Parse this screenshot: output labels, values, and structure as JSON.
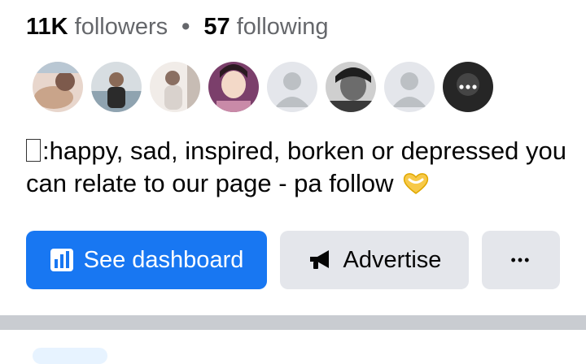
{
  "stats": {
    "followers_count": "11K",
    "followers_label": "followers",
    "separator": "•",
    "following_count": "57",
    "following_label": "following"
  },
  "follower_avatars": [
    {
      "kind": "photo",
      "colors": [
        "#c9a48a",
        "#7d5a4c",
        "#e8d6cc"
      ]
    },
    {
      "kind": "photo",
      "colors": [
        "#8fa3b0",
        "#2b2b2b",
        "#d7dde1"
      ]
    },
    {
      "kind": "photo",
      "colors": [
        "#d9d2cd",
        "#8a6f62",
        "#f1ece8"
      ]
    },
    {
      "kind": "photo",
      "colors": [
        "#7b3f6b",
        "#c98aa8",
        "#f3d9c8"
      ]
    },
    {
      "kind": "default-silhouette",
      "colors": [
        "#e4e6eb",
        "#bcc0c4",
        "#bcc0c4"
      ]
    },
    {
      "kind": "photo",
      "colors": [
        "#3a3a3a",
        "#6c6c6c",
        "#cfcfcf"
      ]
    },
    {
      "kind": "default-silhouette",
      "colors": [
        "#e4e6eb",
        "#bcc0c4",
        "#bcc0c4"
      ]
    },
    {
      "kind": "more-overlay",
      "colors": [
        "#262626",
        "#454545",
        "#ffffff"
      ],
      "label": "•••"
    }
  ],
  "bio": {
    "text": ":happy, sad, inspired, borken or depressed you can relate to our page - pa follow",
    "heart_icon": "yellow-heart-hands-icon"
  },
  "actions": {
    "dashboard_label": "See dashboard",
    "dashboard_icon": "bar-chart-icon",
    "advertise_label": "Advertise",
    "advertise_icon": "megaphone-icon",
    "more_label": "•••"
  },
  "colors": {
    "primary": "#1877f2",
    "secondary_bg": "#e4e6eb",
    "muted_text": "#65676b",
    "divider": "#c9ccd1"
  }
}
